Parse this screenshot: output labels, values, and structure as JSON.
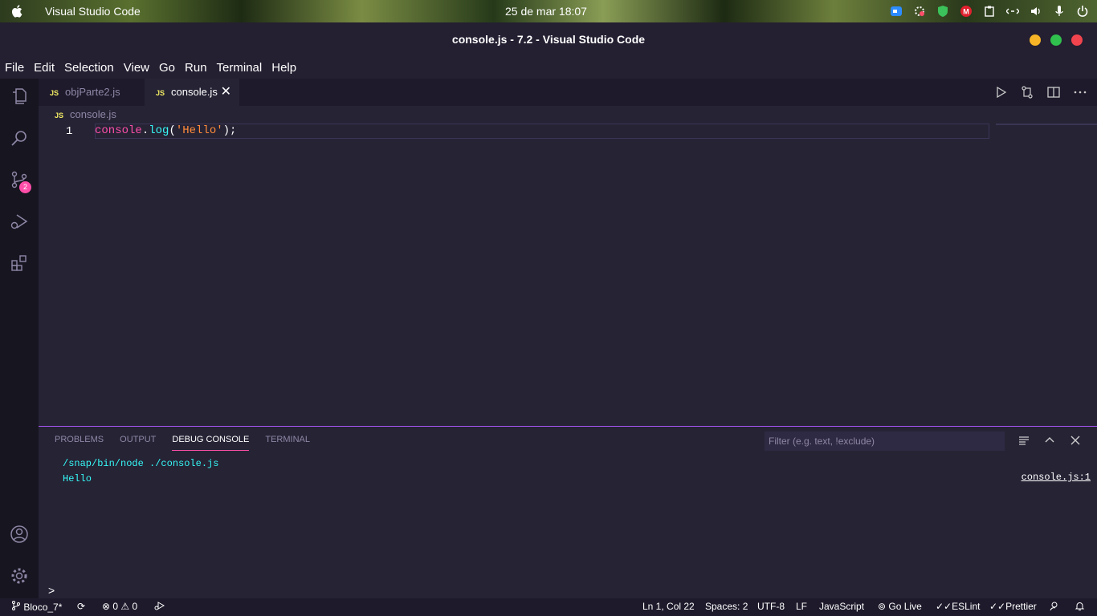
{
  "system": {
    "app_name": "Visual Studio Code",
    "clock": "25 de mar  18:07"
  },
  "window": {
    "title": "console.js - 7.2 - Visual Studio Code"
  },
  "menu": [
    "File",
    "Edit",
    "Selection",
    "View",
    "Go",
    "Run",
    "Terminal",
    "Help"
  ],
  "activity": {
    "scm_badge": "2"
  },
  "tabs": [
    {
      "label": "objParte2.js",
      "icon": "JS"
    },
    {
      "label": "console.js",
      "icon": "JS",
      "close": "✕"
    }
  ],
  "breadcrumb": {
    "icon": "JS",
    "file": "console.js"
  },
  "editor": {
    "line_number": "1",
    "code": {
      "obj": "console",
      "dot": ".",
      "fn": "log",
      "open": "(",
      "str": "'Hello'",
      "close": ");"
    }
  },
  "panel": {
    "tabs": [
      "PROBLEMS",
      "OUTPUT",
      "DEBUG CONSOLE",
      "TERMINAL"
    ],
    "filter_placeholder": "Filter (e.g. text, !exclude)",
    "output": [
      "/snap/bin/node ./console.js",
      "Hello"
    ],
    "source_ref": "console.js:1",
    "prompt": ">"
  },
  "status": {
    "branch": "Bloco_7*",
    "errors": "0",
    "warnings": "0",
    "position": "Ln 1, Col 22",
    "spaces": "Spaces: 2",
    "encoding": "UTF-8",
    "eol": "LF",
    "language": "JavaScript",
    "golive": "Go Live",
    "eslint": "ESLint",
    "prettier": "Prettier"
  },
  "colors": {
    "accent": "#fe4ea9",
    "teal": "#36f9f6",
    "js_yellow": "#f2ec63"
  }
}
